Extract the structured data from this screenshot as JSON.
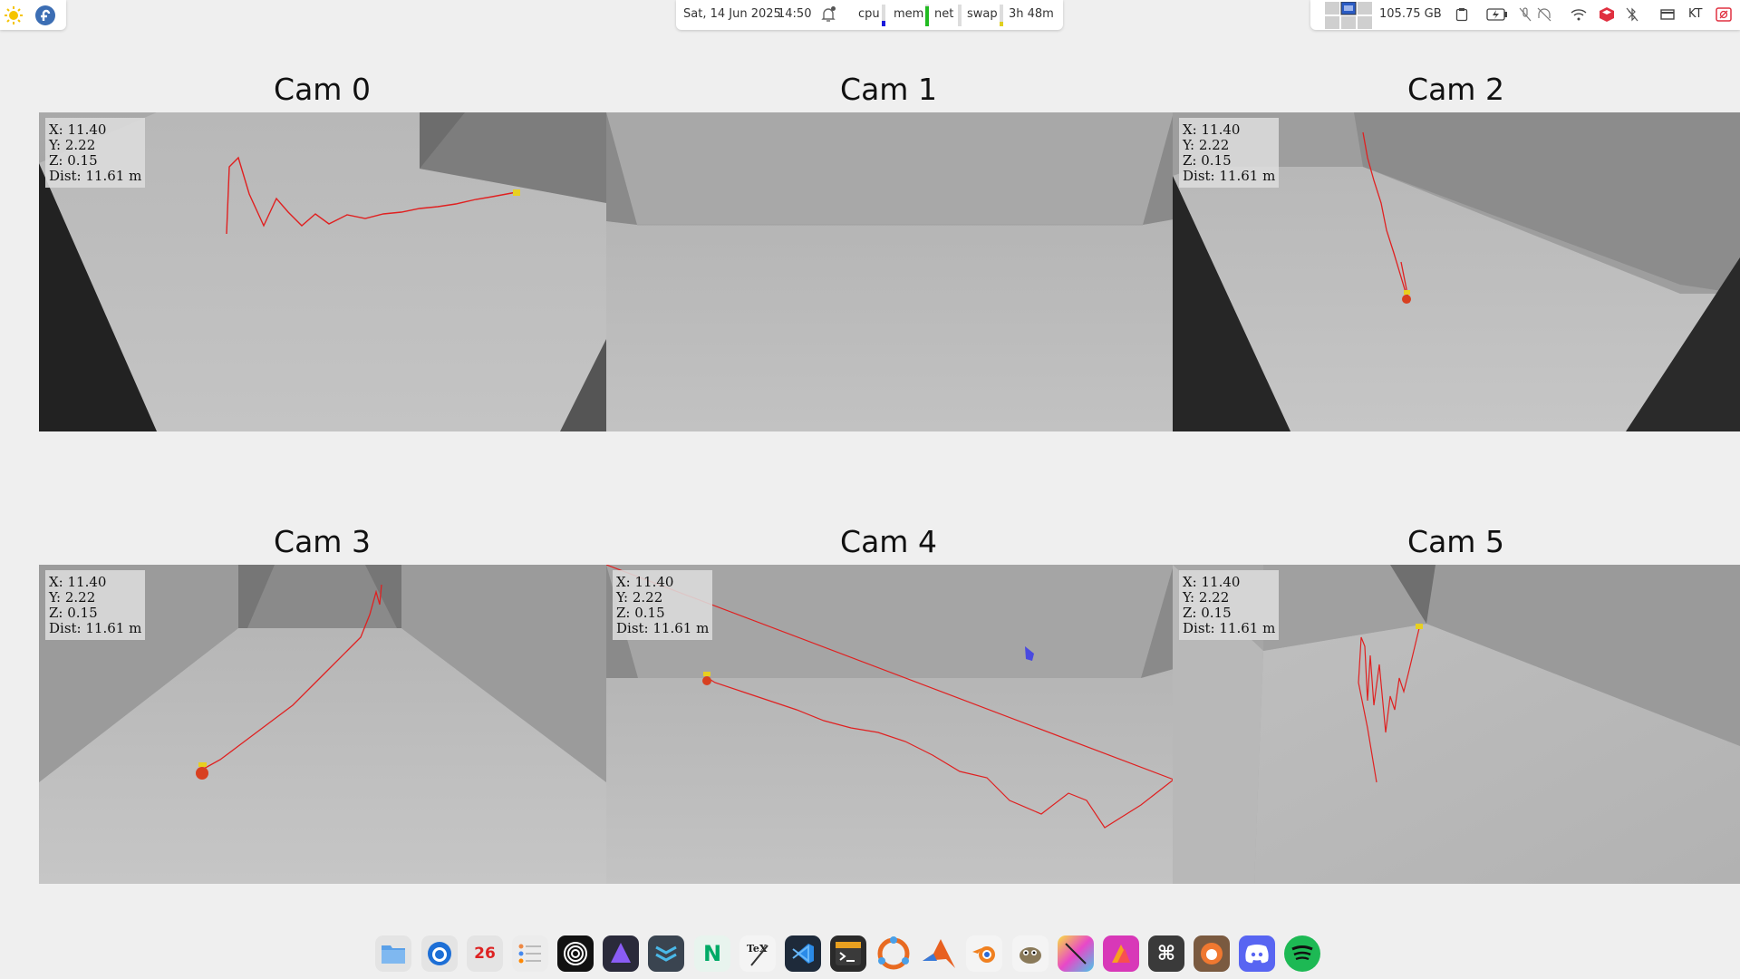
{
  "topbar": {
    "date": "Sat, 14 Jun 2025",
    "time": "14:50",
    "monitors": {
      "cpu": "cpu",
      "mem": "mem",
      "net": "net",
      "swap": "swap"
    },
    "uptime": "3h 48m",
    "disk": "105.75 GB",
    "keyboard_layout": "KT",
    "left_icons": [
      "sun-icon",
      "fedora-logo-icon"
    ],
    "right_icons": [
      "workspace-switcher-icon",
      "clipboard-icon",
      "battery-charging-icon",
      "microphone-muted-icon",
      "headphones-muted-icon",
      "wifi-icon",
      "package-icon",
      "bluetooth-off-icon",
      "display-icon",
      "screen-share-icon"
    ]
  },
  "cameras": [
    {
      "title": "Cam 0",
      "show_coords": true
    },
    {
      "title": "Cam 1",
      "show_coords": false
    },
    {
      "title": "Cam 2",
      "show_coords": true
    },
    {
      "title": "Cam 3",
      "show_coords": true
    },
    {
      "title": "Cam 4",
      "show_coords": true
    },
    {
      "title": "Cam 5",
      "show_coords": true
    }
  ],
  "coords": {
    "x": "X: 11.40",
    "y": "Y: 2.22",
    "z": "Z: 0.15",
    "dist": "Dist: 11.61 m"
  },
  "colors": {
    "trajectory": "#e02020",
    "background": "#efefef",
    "cursor": "#4a4ae0"
  },
  "dock": {
    "calendar_label": "26",
    "apps": [
      "files",
      "thunderbird",
      "calendar",
      "tasks",
      "obs",
      "proton-pass",
      "workspace-app",
      "notion",
      "texmaker",
      "vscode",
      "terminal",
      "ubuntu-app",
      "matlab",
      "blender",
      "gimp",
      "inkscape",
      "affinity",
      "keyboard-shortcuts",
      "firefox-orange",
      "discord",
      "spotify"
    ]
  }
}
